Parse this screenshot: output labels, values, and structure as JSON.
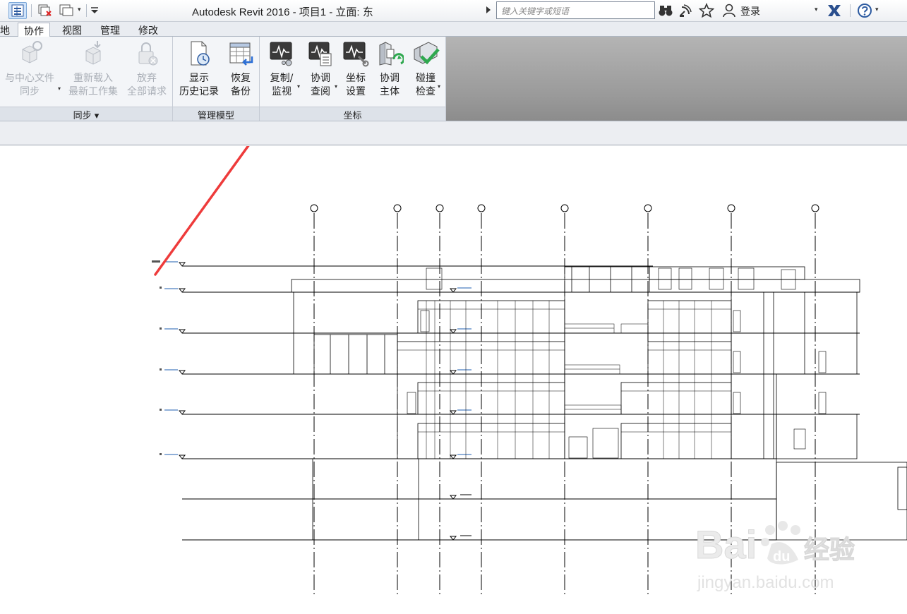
{
  "window": {
    "title": "Autodesk Revit 2016 -    项目1 - 立面: 东",
    "search_placeholder": "键入关键字或短语",
    "login_label": "登录"
  },
  "tabs": [
    {
      "label": "地",
      "active": false
    },
    {
      "label": "协作",
      "active": true
    },
    {
      "label": "视图",
      "active": false
    },
    {
      "label": "管理",
      "active": false
    },
    {
      "label": "修改",
      "active": false
    }
  ],
  "ribbon": {
    "panels": [
      {
        "title": "同步 ▾",
        "buttons": [
          {
            "line1": "与中心文件",
            "line2": "同步",
            "icon": "sync-central-icon",
            "enabled": false,
            "dropdown": true
          },
          {
            "line1": "重新载入",
            "line2": "最新工作集",
            "icon": "reload-latest-icon",
            "enabled": false,
            "dropdown": false
          },
          {
            "line1": "放弃",
            "line2": "全部请求",
            "icon": "relinquish-all-icon",
            "enabled": false,
            "dropdown": false
          }
        ]
      },
      {
        "title": "管理模型",
        "buttons": [
          {
            "line1": "显示",
            "line2": "历史记录",
            "icon": "show-history-icon",
            "enabled": true,
            "dropdown": false
          },
          {
            "line1": "恢复",
            "line2": "备份",
            "icon": "restore-backup-icon",
            "enabled": true,
            "dropdown": false
          }
        ]
      },
      {
        "title": "坐标",
        "buttons": [
          {
            "line1": "复制/",
            "line2": "监视",
            "icon": "copy-monitor-icon",
            "enabled": true,
            "dropdown": true
          },
          {
            "line1": "协调",
            "line2": "查阅",
            "icon": "coordination-review-icon",
            "enabled": true,
            "dropdown": true
          },
          {
            "line1": "坐标",
            "line2": "设置",
            "icon": "coordination-settings-icon",
            "enabled": true,
            "dropdown": false
          },
          {
            "line1": "协调",
            "line2": "主体",
            "icon": "coordination-model-icon",
            "enabled": true,
            "dropdown": false
          },
          {
            "line1": "碰撞",
            "line2": "检查",
            "icon": "interference-check-icon",
            "enabled": true,
            "dropdown": true
          }
        ]
      }
    ]
  },
  "colors": {
    "annotation_arrow": "#ee3b3b",
    "level_tick": "#1f5fb0",
    "ribbon_gray": "#a3a3a3"
  },
  "watermark": {
    "logo_text": "Bai du 经验",
    "url": "jingyan.baidu.com"
  }
}
